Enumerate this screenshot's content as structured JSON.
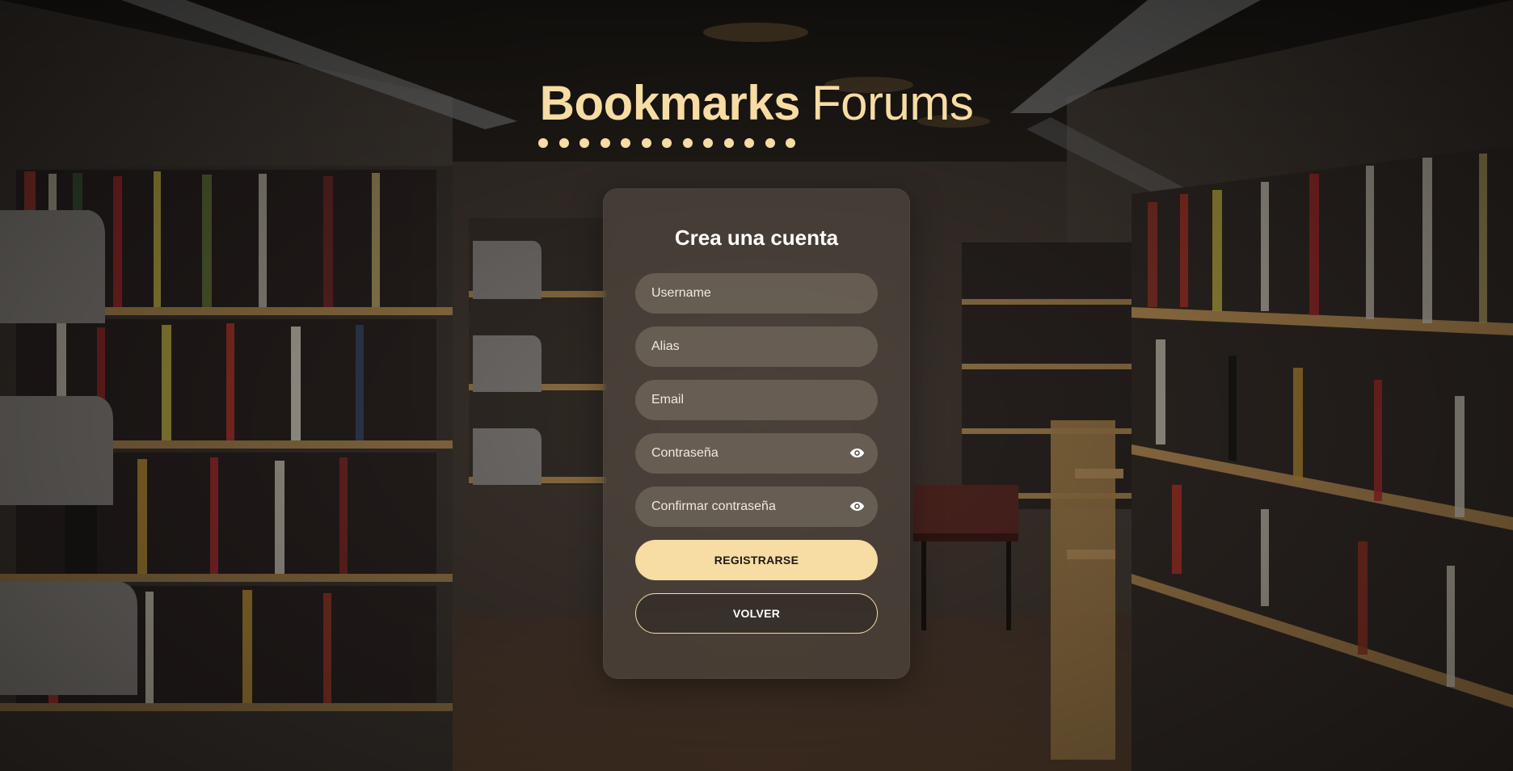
{
  "brand": {
    "name_bold": "Bookmarks",
    "name_light": "Forums",
    "accent_color": "#f7dca3",
    "dot_count": 13
  },
  "register_form": {
    "title": "Crea una cuenta",
    "fields": {
      "username": {
        "placeholder": "Username",
        "value": ""
      },
      "alias": {
        "placeholder": "Alias",
        "value": ""
      },
      "email": {
        "placeholder": "Email",
        "value": ""
      },
      "password": {
        "placeholder": "Contraseña",
        "value": "",
        "icon": "eye-icon"
      },
      "confirm_password": {
        "placeholder": "Confirmar contraseña",
        "value": "",
        "icon": "eye-icon"
      }
    },
    "buttons": {
      "register": "REGISTRARSE",
      "back": "VOLVER"
    }
  },
  "background": {
    "description_icon": "library-bookshelves-photo"
  }
}
